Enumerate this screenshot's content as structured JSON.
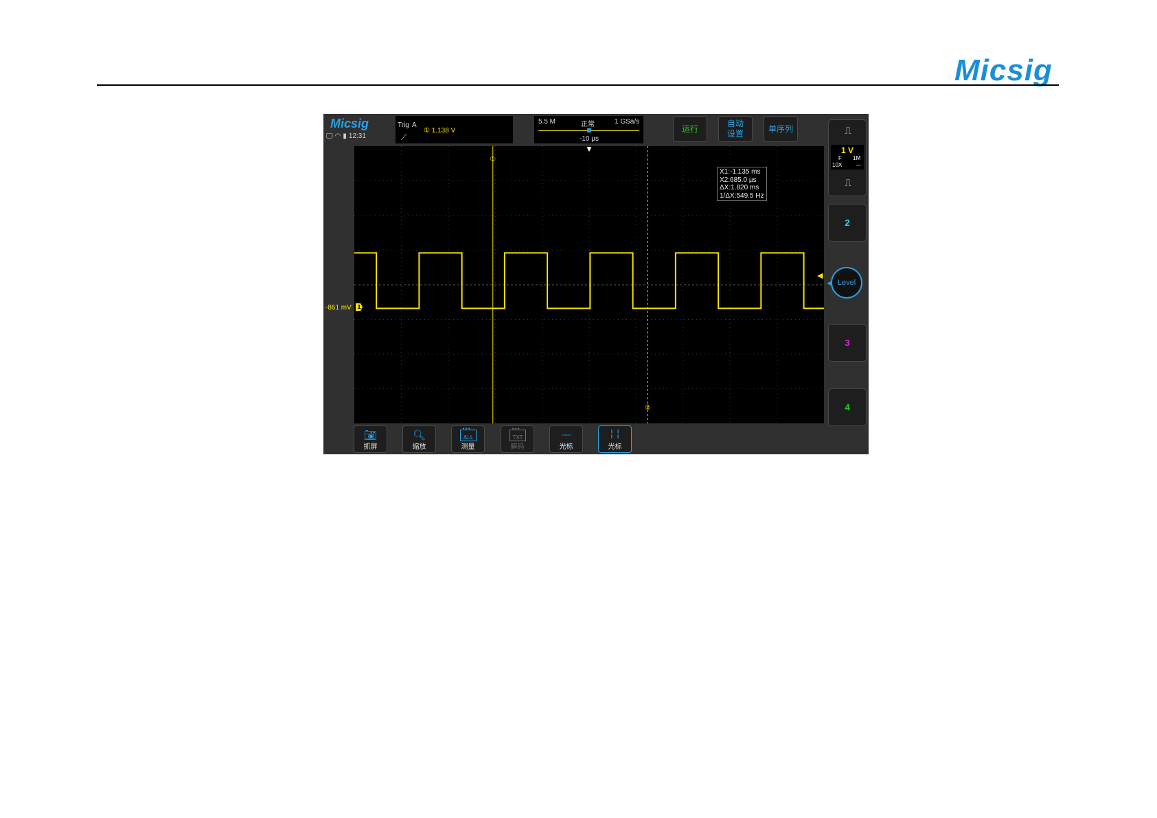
{
  "page": {
    "logo": "Micsig"
  },
  "header": {
    "brand": "Micsig",
    "time": "12:31",
    "status_icons": [
      "monitor-icon",
      "wifi-icon",
      "battery-icon"
    ]
  },
  "trigger": {
    "label": "Trig",
    "source": "A",
    "level": "① 1.138  V"
  },
  "timebase": {
    "memory": "5.5 M",
    "mode": "正常",
    "sample_rate": "1 GSa/s",
    "delay": "-10 µs"
  },
  "top_buttons": {
    "run": "运行",
    "auto": "自动\n设置",
    "single": "单序列"
  },
  "channel1": {
    "scale": "1 V",
    "coupling": "F",
    "impedance": "1M",
    "probe": "10X",
    "dc": "⎓",
    "offset": "-861 mV",
    "marker": "1"
  },
  "right_channels": {
    "ch2": "2",
    "ch3": "3",
    "ch4": "4",
    "level": "Level"
  },
  "cursor_readout": {
    "x1": "X1:-1.135 ms",
    "x2": "X2:685.0 µs",
    "dx": "ΔX:1.820 ms",
    "inv_dx": "1/ΔX:549.5 Hz"
  },
  "cursor_tags": {
    "c1": "①",
    "c2": "②"
  },
  "bottom_buttons": {
    "capture": "抓屏",
    "zoom": "缩放",
    "measure": "测量",
    "measure_tag": "ALL",
    "decode": "解码",
    "decode_tag": "TXT",
    "hcursor": "光标",
    "vcursor": "光标"
  },
  "colors": {
    "ch1": "#f5e400",
    "ch2": "#2ad4f0",
    "ch3": "#e020e0",
    "ch4": "#20d020",
    "accent": "#2aa0e6",
    "run": "#20d020"
  },
  "waveform": {
    "type": "square",
    "high_fraction": 0.385,
    "low_fraction": 0.585,
    "cursor1_fraction": 0.295,
    "cursor2_fraction": 0.625,
    "start_state": "high",
    "edge_fractions": [
      0.047,
      0.138,
      0.229,
      0.32,
      0.411,
      0.502,
      0.593,
      0.684,
      0.775,
      0.866,
      0.957
    ]
  }
}
